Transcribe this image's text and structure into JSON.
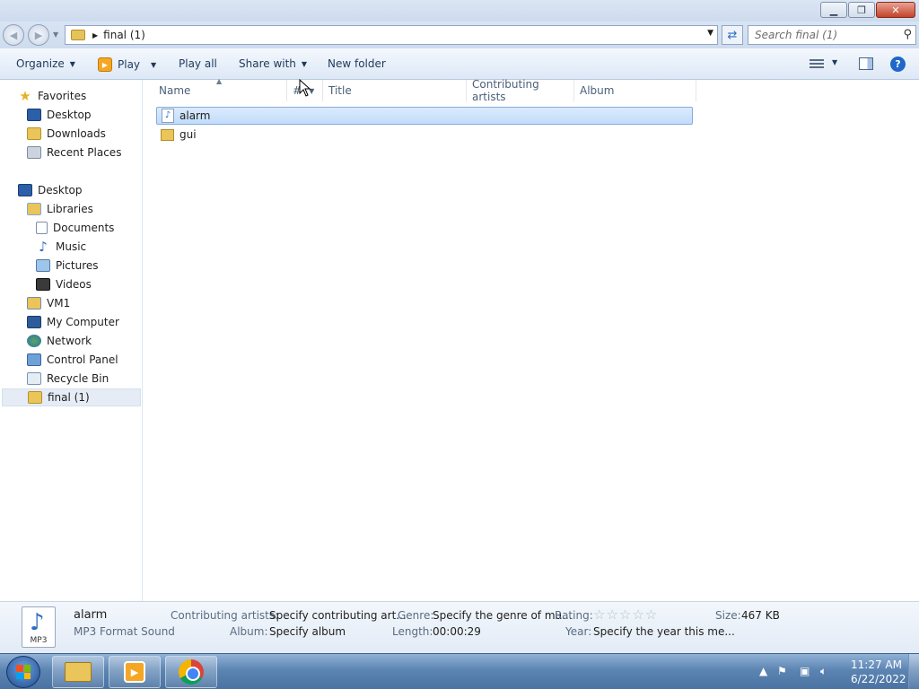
{
  "address": {
    "path": "final (1)",
    "search_placeholder": "Search final (1)"
  },
  "toolbar": {
    "organize": "Organize",
    "play": "Play",
    "play_all": "Play all",
    "share_with": "Share with",
    "new_folder": "New folder"
  },
  "nav": {
    "favorites": "Favorites",
    "desktop_fav": "Desktop",
    "downloads": "Downloads",
    "recent_places": "Recent Places",
    "desktop": "Desktop",
    "libraries": "Libraries",
    "documents": "Documents",
    "music": "Music",
    "pictures": "Pictures",
    "videos": "Videos",
    "vm1": "VM1",
    "my_computer": "My Computer",
    "network": "Network",
    "control_panel": "Control Panel",
    "recycle_bin": "Recycle Bin",
    "current_folder": "final (1)"
  },
  "columns": {
    "name": "Name",
    "number": "#",
    "title": "Title",
    "contributing_artists": "Contributing artists",
    "album": "Album"
  },
  "files": [
    {
      "name": "alarm",
      "icon": "mp3-file-icon",
      "selected": true
    },
    {
      "name": "gui",
      "icon": "folder-icon",
      "selected": false
    }
  ],
  "details": {
    "file_name": "alarm",
    "file_type": "MP3 Format Sound",
    "icon_tag": "MP3",
    "artists_label": "Contributing artists:",
    "artists_value": "Specify contributing art...",
    "album_label": "Album:",
    "album_value": "Specify album",
    "genre_label": "Genre:",
    "genre_value": "Specify the genre of mu...",
    "length_label": "Length:",
    "length_value": "00:00:29",
    "rating_label": "Rating:",
    "rating_stars": 0,
    "year_label": "Year:",
    "year_value": "Specify the year this me...",
    "size_label": "Size:",
    "size_value": "467 KB"
  },
  "taskbar": {
    "time": "11:27 AM",
    "date": "6/22/2022",
    "apps": [
      "windows-explorer",
      "windows-media-player",
      "google-chrome"
    ]
  },
  "colors": {
    "selection": "#cce4fc",
    "selection_border": "#84acdd",
    "taskbar": "#4a72a2",
    "link_text": "#1e395b"
  }
}
